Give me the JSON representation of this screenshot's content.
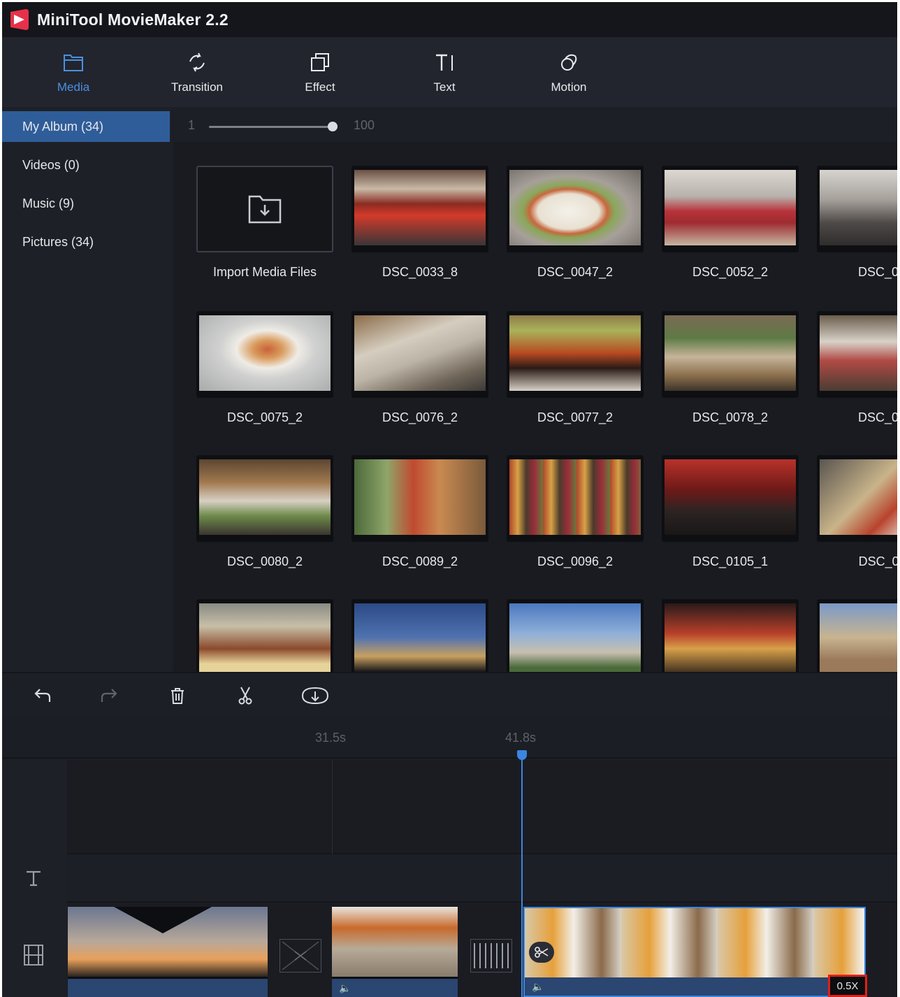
{
  "app": {
    "title": "MiniTool MovieMaker 2.2"
  },
  "toolbar": {
    "items": [
      {
        "label": "Media",
        "icon": "folder-icon"
      },
      {
        "label": "Transition",
        "icon": "transition-icon"
      },
      {
        "label": "Effect",
        "icon": "effect-icon"
      },
      {
        "label": "Text",
        "icon": "text-icon"
      },
      {
        "label": "Motion",
        "icon": "motion-icon"
      }
    ],
    "active_color": "#4a90e2"
  },
  "sidebar": {
    "items": [
      {
        "label": "My Album  (34)"
      },
      {
        "label": "Videos  (0)"
      },
      {
        "label": "Music  (9)"
      },
      {
        "label": "Pictures  (34)"
      }
    ],
    "active_color": "#2f5d99"
  },
  "zoom": {
    "min": "1",
    "max": "100",
    "value": 1.0
  },
  "library": {
    "import_label": "Import Media Files",
    "items": [
      "DSC_0033_8",
      "DSC_0047_2",
      "DSC_0052_2",
      "DSC_006",
      "DSC_0075_2",
      "DSC_0076_2",
      "DSC_0077_2",
      "DSC_0078_2",
      "DSC_007",
      "DSC_0080_2",
      "DSC_0089_2",
      "DSC_0096_2",
      "DSC_0105_1",
      "DSC_011"
    ]
  },
  "timeline": {
    "ruler": [
      "31.5s",
      "41.8s"
    ],
    "speed_badge": "0.5X",
    "tools": [
      "undo-icon",
      "redo-icon",
      "delete-icon",
      "split-icon",
      "zoom-fit-icon"
    ]
  }
}
